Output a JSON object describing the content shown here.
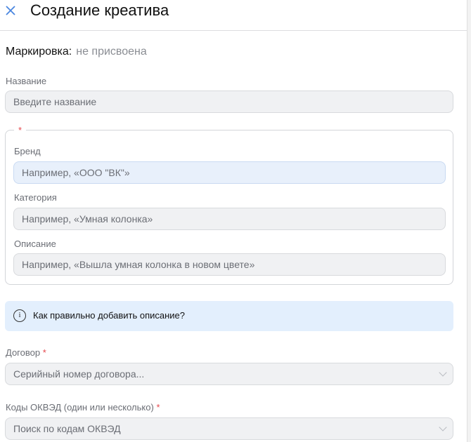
{
  "header": {
    "title": "Создание креатива"
  },
  "marking": {
    "label": "Маркировка:",
    "value": "не присвоена"
  },
  "name_field": {
    "label": "Название",
    "placeholder": "Введите название"
  },
  "group": {
    "legend": "*",
    "brand": {
      "label": "Бренд",
      "placeholder": "Например, «ООО \"ВК\"»"
    },
    "category": {
      "label": "Категория",
      "placeholder": "Например,  «Умная колонка»"
    },
    "description": {
      "label": "Описание",
      "placeholder": "Например, «Вышла умная колонка в новом цвете»"
    }
  },
  "info": {
    "text": "Как правильно добавить описание?"
  },
  "contract": {
    "label": "Договор",
    "required": "*",
    "placeholder": "Серийный номер договора..."
  },
  "okved": {
    "label": "Коды ОКВЭД (один или несколько)",
    "required": "*",
    "placeholder": "Поиск по кодам ОКВЭД"
  },
  "colors": {
    "accent": "#4a86e0",
    "required": "#e5484d",
    "info_bg": "#e3effd"
  }
}
